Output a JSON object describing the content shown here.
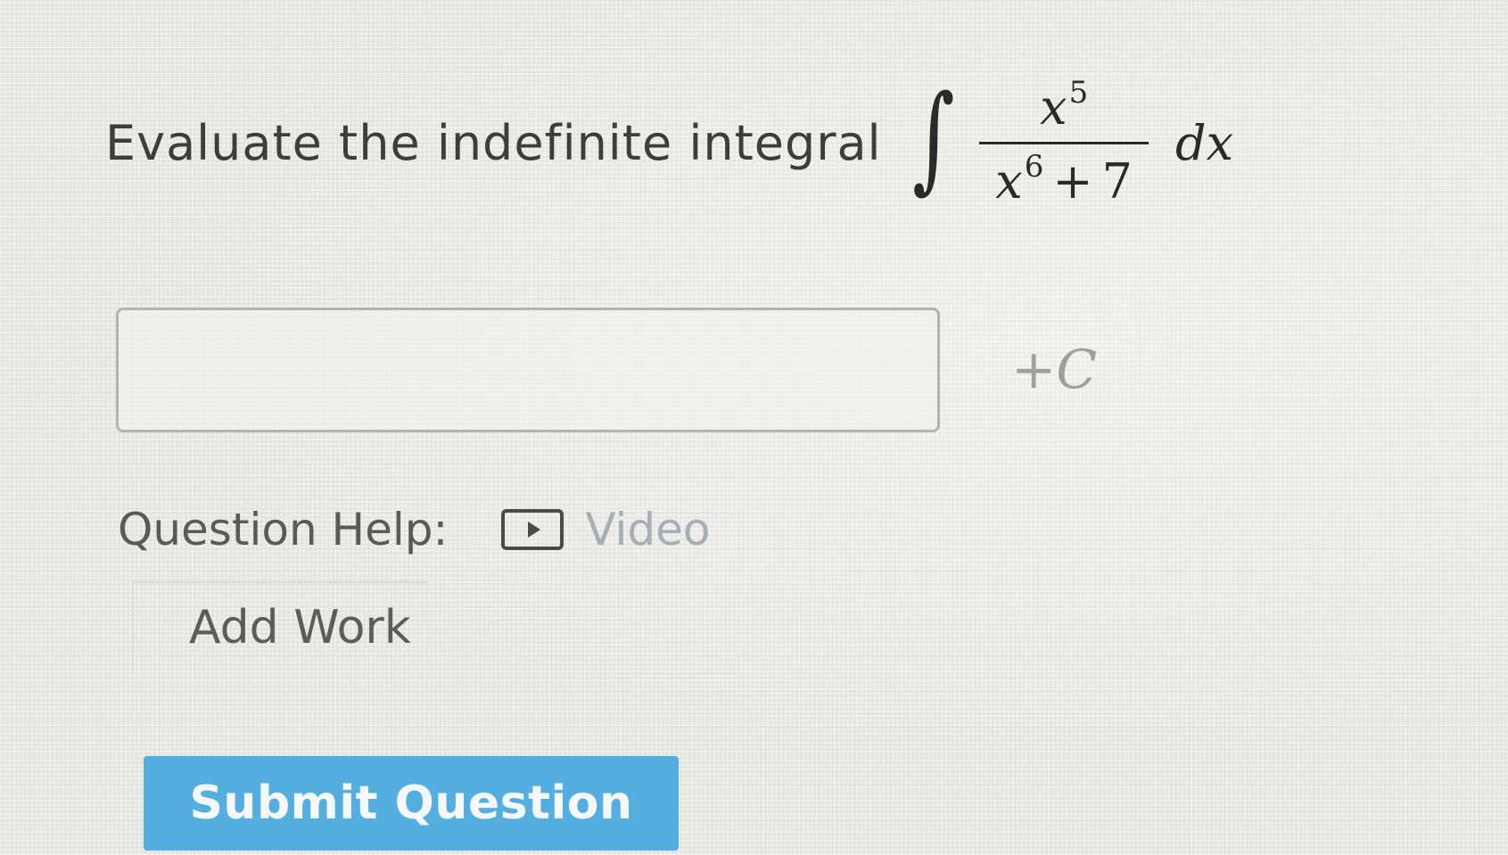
{
  "question": {
    "prompt": "Evaluate the indefinite integral",
    "integral_symbol": "∫",
    "numerator": {
      "base": "x",
      "exponent": "5"
    },
    "denominator": {
      "base": "x",
      "exponent": "6",
      "operator": "+",
      "constant": "7"
    },
    "differential": "dx"
  },
  "answer": {
    "value": "",
    "constant_plus": "+",
    "constant_symbol": "C"
  },
  "help": {
    "label": "Question Help:",
    "video_label": "Video",
    "video_icon": "play-icon"
  },
  "add_work": {
    "label": "Add Work"
  },
  "submit": {
    "label": "Submit Question"
  },
  "colors": {
    "background": "#ebebe6",
    "submit_button": "#55aee0",
    "link": "#a7aeb6",
    "text": "#3d3d3d"
  }
}
